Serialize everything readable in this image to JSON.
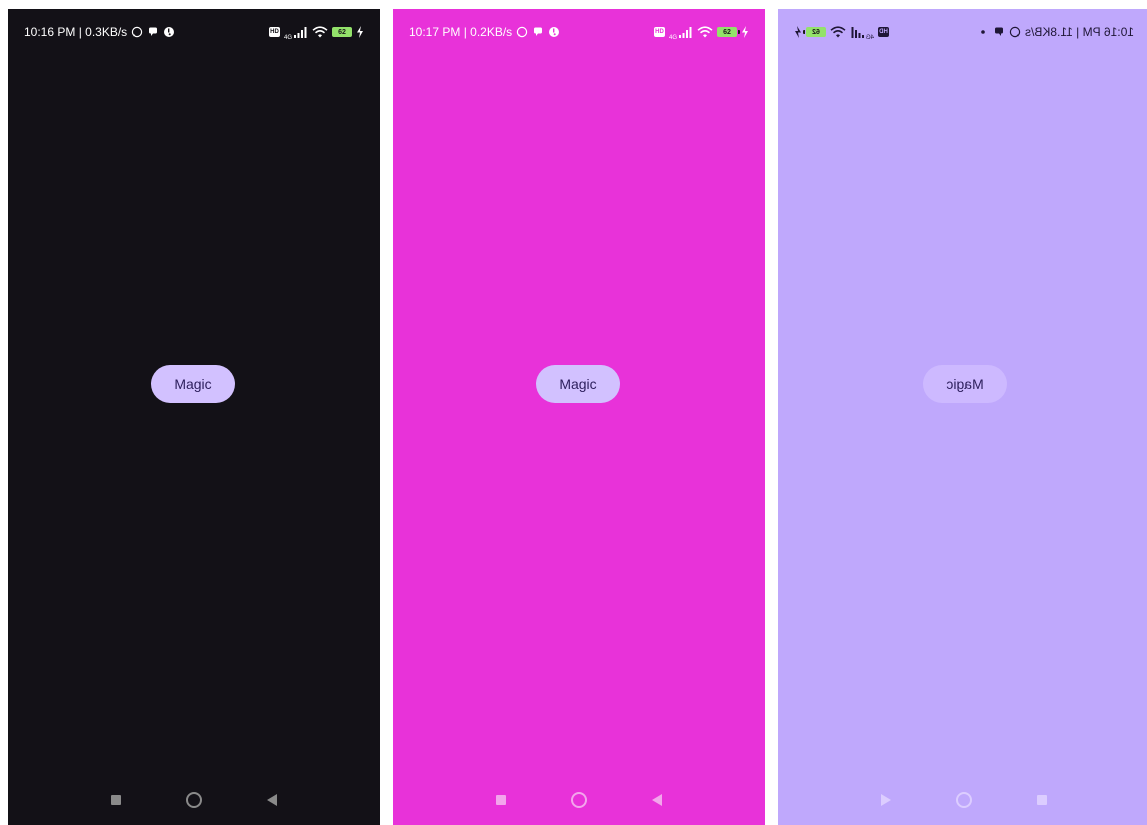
{
  "colors": {
    "phone_1_bg": "#131117",
    "phone_2_bg": "#e832d9",
    "phone_3_bg": "#bfa8fc",
    "button_bg": "#d2c1ff",
    "button_text": "#2d1f5c",
    "wifi_green": "#6fd36d",
    "battery_green": "#93e26a"
  },
  "screens": [
    {
      "status": {
        "time_speed": "10:16 PM | 0.3KB/s",
        "icons_left": [
          "whatsapp-icon",
          "chat-bubble-icon",
          "app-notification-icon"
        ],
        "icons_right": [
          "hd-volte-icon",
          "4g-signal-icon",
          "wifi-icon",
          "battery-icon",
          "charging-icon"
        ],
        "network": "4G",
        "hd_badge": "HD",
        "battery": "62"
      },
      "button": {
        "label": "Magic"
      },
      "nav": [
        "recent-apps-square-icon",
        "home-circle-icon",
        "back-triangle-icon"
      ]
    },
    {
      "status": {
        "time_speed": "10:17 PM | 0.2KB/s",
        "icons_left": [
          "whatsapp-icon",
          "chat-bubble-icon",
          "app-notification-icon"
        ],
        "icons_right": [
          "hd-volte-icon",
          "4g-signal-icon",
          "wifi-icon",
          "battery-icon",
          "charging-icon"
        ],
        "network": "4G",
        "hd_badge": "HD",
        "battery": "62"
      },
      "button": {
        "label": "Magic"
      },
      "nav": [
        "recent-apps-square-icon",
        "home-circle-icon",
        "back-triangle-icon"
      ]
    },
    {
      "mirrored": true,
      "status": {
        "time_speed": "10:16 PM | 11.8KB/s",
        "icons_left": [
          "whatsapp-icon",
          "chat-bubble-icon",
          "dot-icon"
        ],
        "icons_right": [
          "hd-volte-icon",
          "4g-signal-icon",
          "wifi-icon",
          "battery-icon",
          "charging-icon"
        ],
        "network": "4G",
        "hd_badge": "HD",
        "battery": "62"
      },
      "button": {
        "label": "Magic"
      },
      "nav": [
        "recent-apps-square-icon",
        "home-circle-icon",
        "back-triangle-icon"
      ]
    }
  ]
}
